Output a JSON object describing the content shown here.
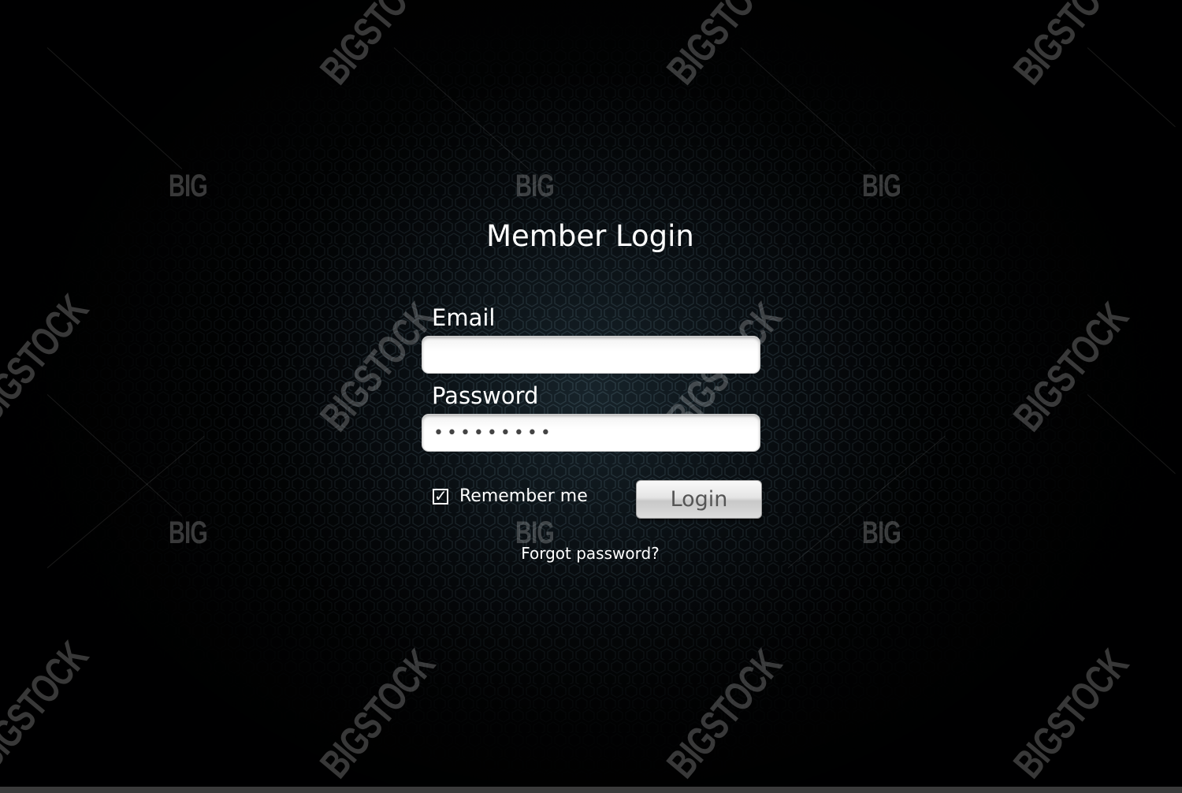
{
  "login_form": {
    "title": "Member Login",
    "email_label": "Email",
    "email_value": "",
    "password_label": "Password",
    "password_value": "•••••••••",
    "remember_label": "Remember me",
    "remember_checked": true,
    "remember_glyph": "✓",
    "login_button": "Login",
    "forgot_link": "Forgot password?"
  },
  "watermarks": {
    "big": "BIG",
    "bigstock": "BIGSTOCK"
  },
  "colors": {
    "background": "#020304",
    "text": "#ffffff",
    "input_bg": "#ffffff",
    "button_bg": "#dcdcdc",
    "button_text": "#555555"
  },
  "icons": {
    "checkbox": "checkbox-checked-icon"
  }
}
